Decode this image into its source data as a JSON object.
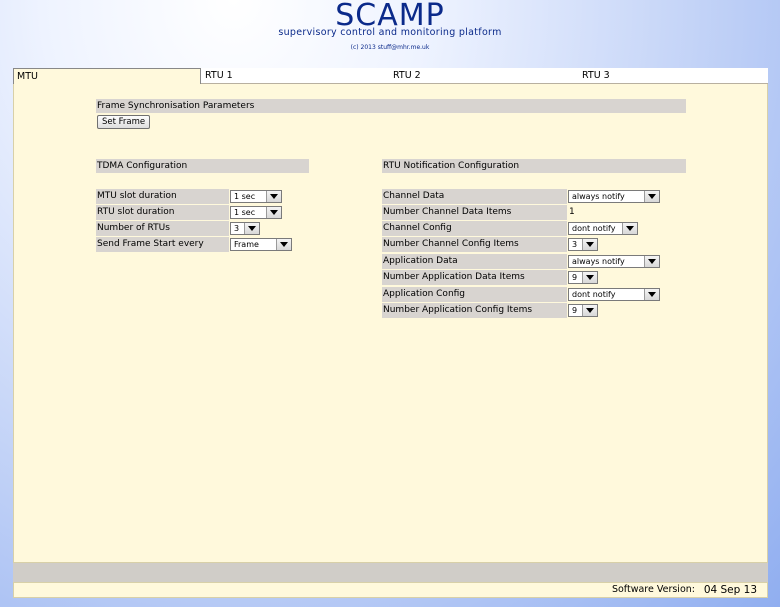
{
  "header": {
    "logo": "SCAMP",
    "tagline": "supervisory control and monitoring platform",
    "copyright": "(c) 2013 stuff@mhr.me.uk"
  },
  "tabs": [
    "MTU",
    "RTU 1",
    "RTU 2",
    "RTU 3"
  ],
  "frame_sync": {
    "title": "Frame Synchronisation Parameters",
    "button": "Set Frame"
  },
  "tdma": {
    "title": "TDMA Configuration",
    "rows": [
      {
        "label": "MTU slot duration",
        "value": "1 sec"
      },
      {
        "label": "RTU slot duration",
        "value": "1 sec"
      },
      {
        "label": "Number of RTUs",
        "value": "3"
      },
      {
        "label": "Send Frame Start every",
        "value": "Frame"
      }
    ]
  },
  "rtu_notify": {
    "title": "RTU Notification Configuration",
    "rows": [
      {
        "label": "Channel Data",
        "value": "always notify"
      },
      {
        "label": "Number Channel Data Items",
        "value": "1"
      },
      {
        "label": "Channel Config",
        "value": "dont notify"
      },
      {
        "label": "Number Channel Config Items",
        "value": "3"
      },
      {
        "label": "Application Data",
        "value": "always notify"
      },
      {
        "label": "Number Application Data Items",
        "value": "9"
      },
      {
        "label": "Application Config",
        "value": "dont notify"
      },
      {
        "label": "Number Application Config Items",
        "value": "9"
      }
    ]
  },
  "footer": {
    "label": "Software Version:",
    "version": "04 Sep 13"
  }
}
